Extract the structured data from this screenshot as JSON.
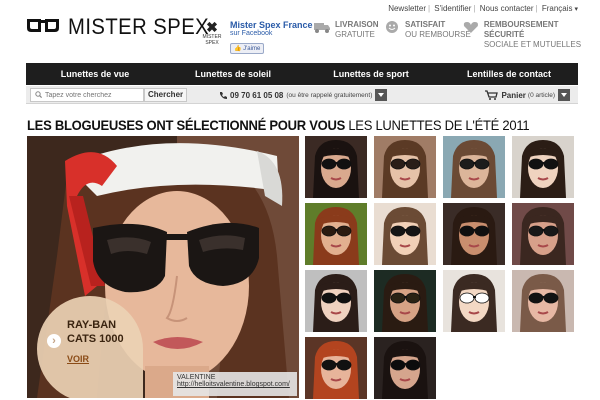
{
  "toplinks": {
    "newsletter": "Newsletter",
    "login": "S'identifier",
    "contact": "Nous contacter",
    "lang": "Français"
  },
  "brand": {
    "name": "MISTER SPEX"
  },
  "facebook": {
    "mark_small": "MISTER SPEX",
    "title": "Mister Spex France",
    "subtitle": "sur Facebook",
    "like": "J'aime"
  },
  "benefits": [
    {
      "title": "LIVRAISON",
      "sub": "GRATUITE",
      "icon": "truck-icon"
    },
    {
      "title": "SATISFAIT",
      "sub": "OU REMBOURSÉ",
      "icon": "smiley-icon"
    },
    {
      "title": "REMBOURSEMENT SÉCURITÉ",
      "sub": "SOCIALE ET MUTUELLES",
      "icon": "heart-icon"
    }
  ],
  "nav": [
    "Lunettes de vue",
    "Lunettes de soleil",
    "Lunettes de sport",
    "Lentilles de contact"
  ],
  "search": {
    "placeholder": "Tapez votre cherchez",
    "button": "Chercher"
  },
  "phone": {
    "number": "09 70 61 05 08",
    "note": "(ou être rappelé gratuitement)"
  },
  "cart": {
    "label": "Panier",
    "count": "(0 article)"
  },
  "headline": {
    "bold": "LES BLOGUEUSES ONT SÉLECTIONNÉ POUR VOUS",
    "light": "LES LUNETTES DE L'ÉTÉ 2011"
  },
  "promo": {
    "title": "RAY-BAN CATS 1000",
    "cta": "VOIR"
  },
  "credit": {
    "name": "VALENTINE",
    "url": "http://helloitsvalentine.blogspot.com/"
  },
  "colors": {
    "nav": "#1e1e1e",
    "link": "#2a5ba8",
    "cta": "#8a4b16",
    "promo": "#ecd1b4"
  },
  "thumbs": [
    {
      "bg": "#3b2a24",
      "skin": "#d9a98e",
      "hair": "#1a1210",
      "lens": "#111"
    },
    {
      "bg": "#a07c66",
      "skin": "#e6c2a8",
      "hair": "#5b3a25",
      "lens": "#2a1e18"
    },
    {
      "bg": "#8aa8b3",
      "skin": "#dcb59a",
      "hair": "#6b4a35",
      "lens": "#1c1c1c"
    },
    {
      "bg": "#d8d3cc",
      "skin": "#efd3bf",
      "hair": "#2b1d15",
      "lens": "#111"
    },
    {
      "bg": "#5f7d2a",
      "skin": "#e2b08f",
      "hair": "#8a3b1b",
      "lens": "#2b1b10"
    },
    {
      "bg": "#e9ddd2",
      "skin": "#f1d0b7",
      "hair": "#6b4b35",
      "lens": "#151515"
    },
    {
      "bg": "#3a2c27",
      "skin": "#c98e6e",
      "hair": "#2a1a12",
      "lens": "#0f0f0f"
    },
    {
      "bg": "#704a48",
      "skin": "#d7a08a",
      "hair": "#3b2720",
      "lens": "#181818"
    },
    {
      "bg": "#bfbfbf",
      "skin": "#efd2c0",
      "hair": "#2b1d18",
      "lens": "#111"
    },
    {
      "bg": "#1d2b23",
      "skin": "#d6a285",
      "hair": "#2a1b12",
      "lens": "#2a2214"
    },
    {
      "bg": "#e8e3dd",
      "skin": "#f3d8c4",
      "hair": "#3b2a22",
      "lens": "#ffffff"
    },
    {
      "bg": "#c9b8b0",
      "skin": "#e7b8a4",
      "hair": "#7a5a48",
      "lens": "#121212"
    },
    {
      "bg": "#5b3526",
      "skin": "#e7b49a",
      "hair": "#b3441f",
      "lens": "#111"
    },
    {
      "bg": "#2a2220",
      "skin": "#d5a58d",
      "hair": "#1a1210",
      "lens": "#0c0c0c"
    }
  ]
}
